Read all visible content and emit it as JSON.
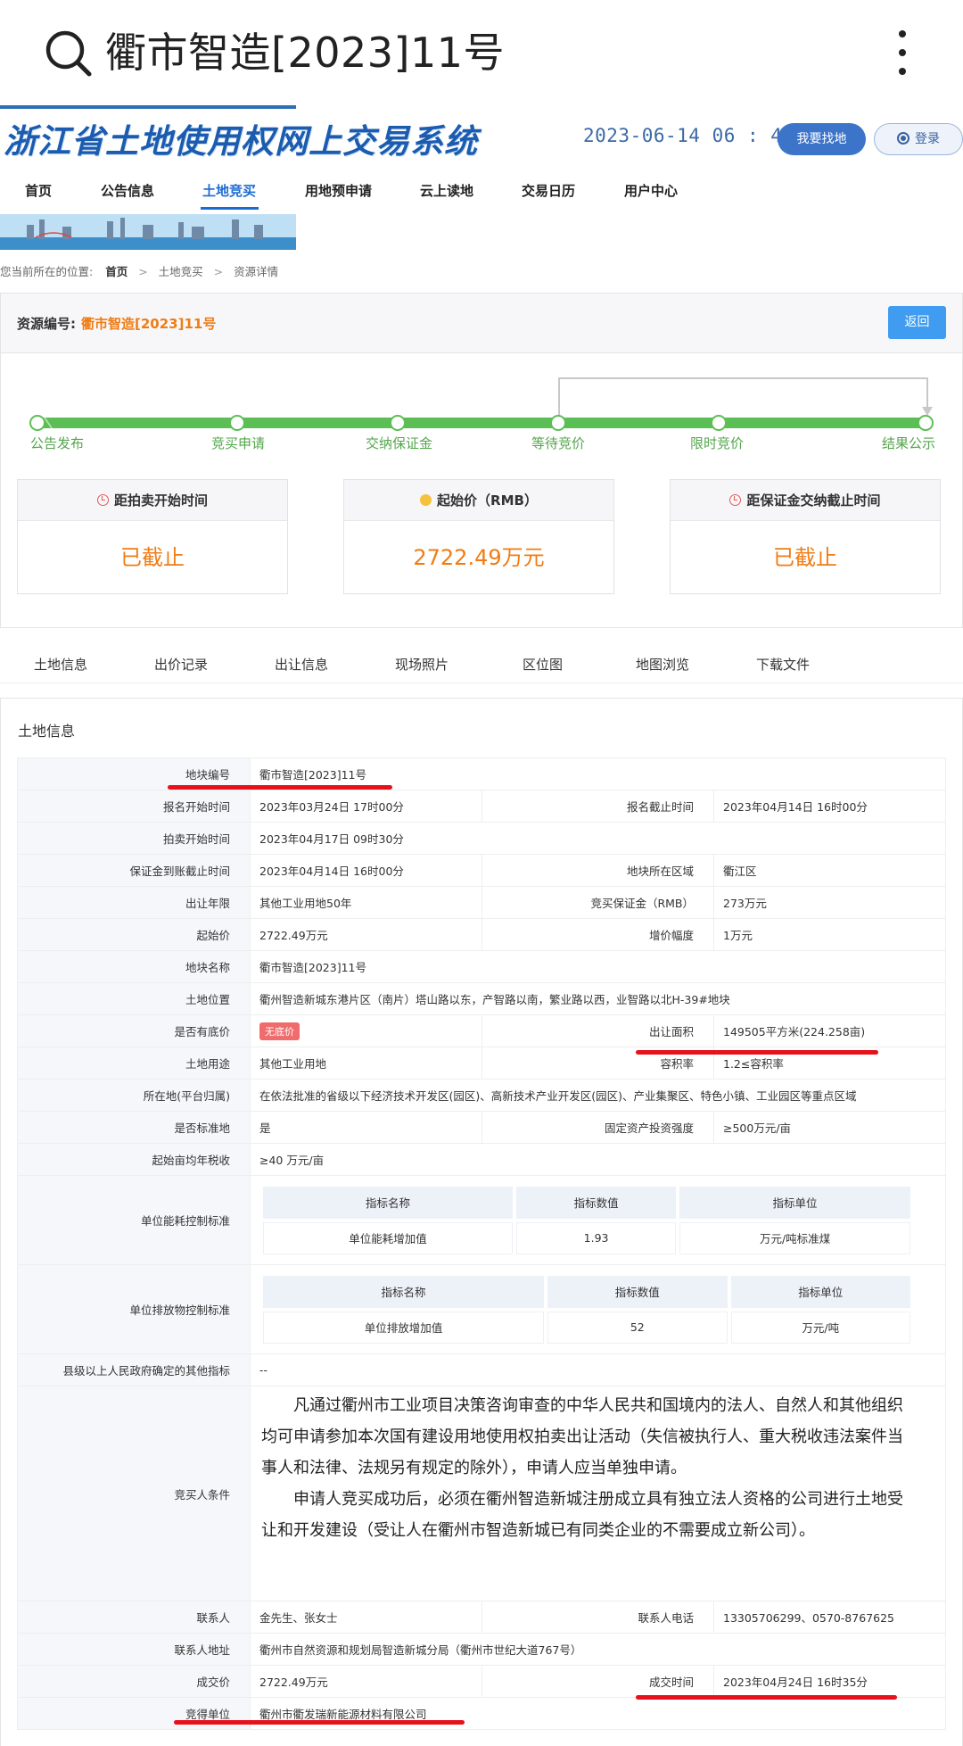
{
  "search": {
    "query": "衢市智造[2023]11号"
  },
  "header": {
    "system_title": "浙江省土地使用权网上交易系统",
    "clock": "2023-06-14 06 : 46 : 49",
    "find_land": "我要找地",
    "login": "登录"
  },
  "nav": [
    "首页",
    "公告信息",
    "土地竞买",
    "用地预申请",
    "云上读地",
    "交易日历",
    "用户中心"
  ],
  "breadcrumb": {
    "prefix": "您当前所在的位置:",
    "items": [
      "首页",
      "土地竞买",
      "资源详情"
    ],
    "sep": ">"
  },
  "resource": {
    "label": "资源编号:",
    "code": "衢市智造[2023]11号",
    "back": "返回"
  },
  "progress": {
    "steps": [
      "公告发布",
      "竞买申请",
      "交纳保证金",
      "等待竞价",
      "限时竞价",
      "结果公示"
    ],
    "colors": {
      "done": "#5cbf55",
      "node": "#ffffff"
    }
  },
  "cards": [
    {
      "title": "距拍卖开始时间",
      "value": "已截止",
      "icon": "clock-icon"
    },
    {
      "title": "起始价（RMB）",
      "value": "2722.49万元",
      "icon": "coin-icon"
    },
    {
      "title": "距保证金交纳截止时间",
      "value": "已截止",
      "icon": "clock-icon"
    }
  ],
  "tabs": [
    "土地信息",
    "出价记录",
    "出让信息",
    "现场照片",
    "区位图",
    "地图浏览",
    "下载文件"
  ],
  "land": {
    "title": "土地信息",
    "block_no_k": "地块编号",
    "block_no_v": "衢市智造[2023]11号",
    "reg_start_k": "报名开始时间",
    "reg_start_v": "2023年03月24日 17时00分",
    "reg_end_k": "报名截止时间",
    "reg_end_v": "2023年04月14日 16时00分",
    "auction_start_k": "拍卖开始时间",
    "auction_start_v": "2023年04月17日 09时30分",
    "deposit_deadline_k": "保证金到账截止时间",
    "deposit_deadline_v": "2023年04月14日 16时00分",
    "area_k": "地块所在区域",
    "area_v": "衢江区",
    "term_k": "出让年限",
    "term_v": "其他工业用地50年",
    "deposit_k": "竞买保证金（RMB）",
    "deposit_v": "273万元",
    "start_price_k": "起始价",
    "start_price_v": "2722.49万元",
    "increment_k": "增价幅度",
    "increment_v": "1万元",
    "name_k": "地块名称",
    "name_v": "衢市智造[2023]11号",
    "location_k": "土地位置",
    "location_v": "衢州智造新城东港片区（南片）塔山路以东，产智路以南，繁业路以西，业智路以北H-39#地块",
    "reserve_k": "是否有底价",
    "reserve_v": "无底价",
    "land_area_k": "出让面积",
    "land_area_v": "149505平方米(224.258亩)",
    "use_k": "土地用途",
    "use_v": "其他工业用地",
    "far_k": "容积率",
    "far_v": "1.2≤容积率",
    "zone_k": "所在地(平台归属)",
    "zone_v": "在依法批准的省级以下经济技术开发区(园区)、高新技术产业开发区(园区)、产业集聚区、特色小镇、工业园区等重点区域",
    "standard_k": "是否标准地",
    "standard_v": "是",
    "invest_k": "固定资产投资强度",
    "invest_v": "≥500万元/亩",
    "tax_k": "起始亩均年税收",
    "tax_v": "≥40 万元/亩",
    "energy_k": "单位能耗控制标准",
    "emission_k": "单位排放物控制标准",
    "sub_headers": [
      "指标名称",
      "指标数值",
      "指标单位"
    ],
    "energy_row": [
      "单位能耗增加值",
      "1.93",
      "万元/吨标准煤"
    ],
    "emission_row": [
      "单位排放增加值",
      "52",
      "万元/吨"
    ],
    "other_k": "县级以上人民政府确定的其他指标",
    "other_v": "--",
    "cond_k": "竞买人条件",
    "cond_p1": "凡通过衢州市工业项目决策咨询审查的中华人民共和国境内的法人、自然人和其他组织均可申请参加本次国有建设用地使用权拍卖出让活动（失信被执行人、重大税收违法案件当事人和法律、法规另有规定的除外），申请人应当单独申请。",
    "cond_p2": "申请人竞买成功后，必须在衢州智造新城注册成立具有独立法人资格的公司进行土地受让和开发建设（受让人在衢州市智造新城已有同类企业的不需要成立新公司）。",
    "contact_k": "联系人",
    "contact_v": "金先生、张女士",
    "phone_k": "联系人电话",
    "phone_v": "13305706299、0570-8767625",
    "address_k": "联系人地址",
    "address_v": "衢州市自然资源和规划局智造新城分局（衢州市世纪大道767号）",
    "deal_price_k": "成交价",
    "deal_price_v": "2722.49万元",
    "deal_time_k": "成交时间",
    "deal_time_v": "2023年04月24日 16时35分",
    "winner_k": "竞得单位",
    "winner_v": "衢州市衢发瑞新能源材料有限公司"
  }
}
